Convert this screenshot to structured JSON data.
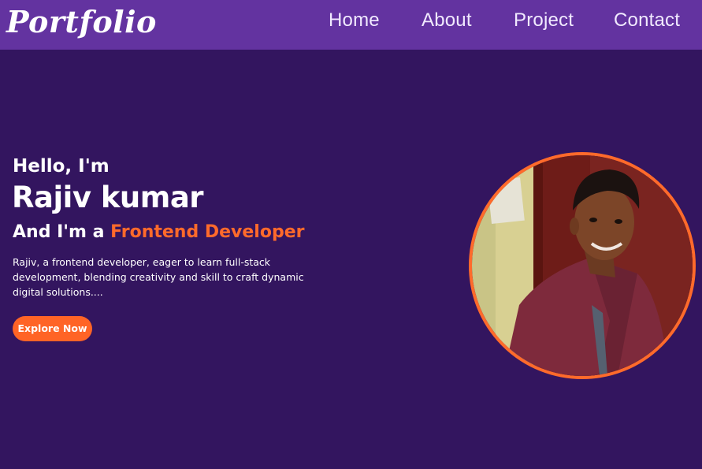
{
  "header": {
    "logo": "Portfolio",
    "nav": [
      {
        "label": "Home"
      },
      {
        "label": "About"
      },
      {
        "label": "Project"
      },
      {
        "label": "Contact"
      }
    ]
  },
  "hero": {
    "greeting": "Hello, I'm",
    "name": "Rajiv kumar",
    "role_prefix": "And I'm a ",
    "role_highlight": "Frontend Developer",
    "bio": "Rajiv, a frontend developer, eager to learn full-stack development, blending creativity and skill to craft dynamic digital solutions....",
    "cta_label": "Explore Now"
  },
  "colors": {
    "background": "#33155f",
    "navbar": "#6333a0",
    "accent": "#ff6a2b",
    "text": "#ffffff"
  }
}
